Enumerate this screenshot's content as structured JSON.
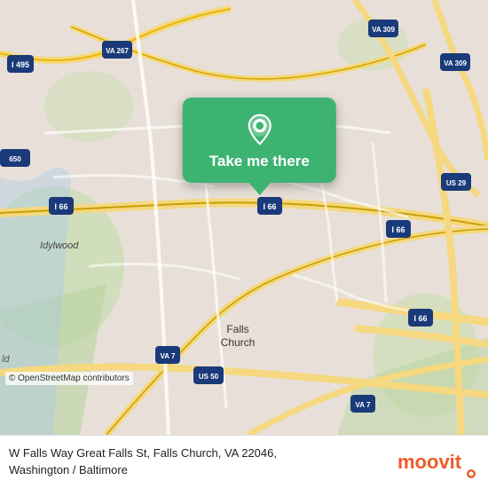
{
  "map": {
    "background_color": "#e8e0d8",
    "attribution": "© OpenStreetMap contributors"
  },
  "callout": {
    "label": "Take me there",
    "background_color": "#3cb371",
    "pin_icon": "location-pin"
  },
  "footer": {
    "address_line1": "W Falls Way Great Falls St, Falls Church, VA 22046,",
    "address_line2": "Washington / Baltimore",
    "logo_alt": "Moovit"
  }
}
